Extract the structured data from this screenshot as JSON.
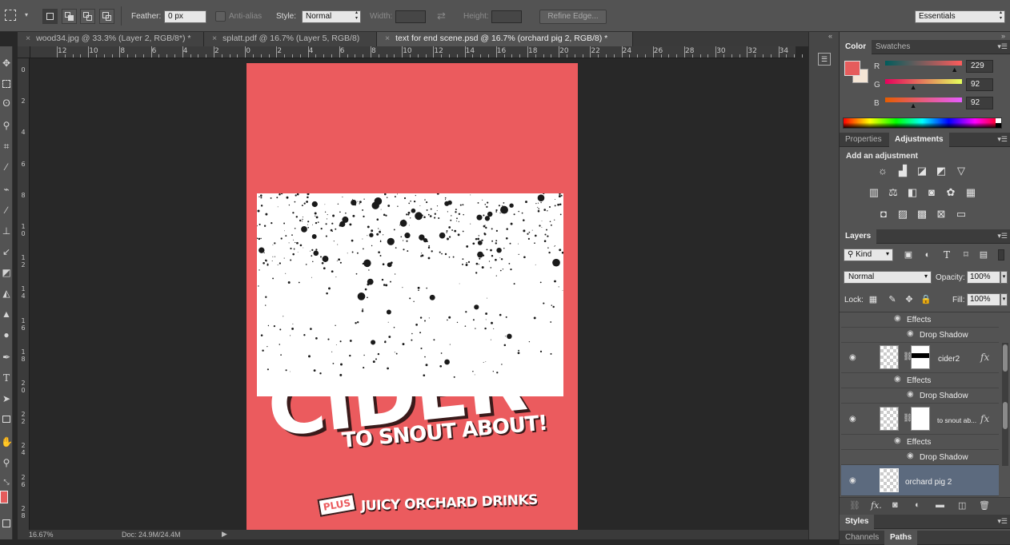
{
  "options_bar": {
    "feather_label": "Feather:",
    "feather_value": "0 px",
    "antialias_label": "Anti-alias",
    "style_label": "Style:",
    "style_value": "Normal",
    "width_label": "Width:",
    "height_label": "Height:",
    "refine_edge_label": "Refine Edge...",
    "workspace_value": "Essentials"
  },
  "tabs": [
    {
      "label": "wood34.jpg @ 33.3% (Layer 2, RGB/8*) *"
    },
    {
      "label": "splatt.pdf @ 16.7% (Layer 5, RGB/8)"
    },
    {
      "label": "text for end scene.psd @ 16.7% (orchard pig 2, RGB/8) *"
    }
  ],
  "ruler_h": [
    "12",
    "10",
    "8",
    "6",
    "4",
    "2",
    "0",
    "2",
    "4",
    "6",
    "8",
    "10",
    "12",
    "14",
    "16",
    "18",
    "20",
    "22",
    "24",
    "26",
    "28",
    "30",
    "32",
    "34"
  ],
  "ruler_v": [
    "0",
    "2",
    "4",
    "6",
    "8",
    "10",
    "12",
    "14",
    "16",
    "18",
    "20",
    "22",
    "24",
    "26",
    "28"
  ],
  "artwork": {
    "headline": "CIDER",
    "tagline": "TO SNOUT ABOUT!",
    "plus_badge": "PLUS",
    "footer": "JUICY ORCHARD DRINKS"
  },
  "status": {
    "zoom": "16.67%",
    "doc": "Doc: 24.9M/24.4M"
  },
  "color_panel": {
    "tab_color": "Color",
    "tab_swatches": "Swatches",
    "r_label": "R",
    "g_label": "G",
    "b_label": "B",
    "r_value": "229",
    "g_value": "92",
    "b_value": "92",
    "r_level": 0.898,
    "g_level": 0.361,
    "b_level": 0.361,
    "foreground": "#e55c5c",
    "background": "#f5e6d6"
  },
  "adjustments_panel": {
    "tab_properties": "Properties",
    "tab_adjustments": "Adjustments",
    "heading": "Add an adjustment",
    "icons": [
      "brightness-icon",
      "levels-icon",
      "curves-icon",
      "exposure-icon",
      "vibrance-icon",
      "hue-saturation-icon",
      "color-balance-icon",
      "black-white-icon",
      "photo-filter-icon",
      "channel-mixer-icon",
      "color-lookup-icon",
      "invert-icon",
      "posterize-icon",
      "threshold-icon",
      "gradient-map-icon",
      "selective-color-icon"
    ]
  },
  "layers_panel": {
    "tab_layers": "Layers",
    "kind_label": "Kind",
    "blend_mode": "Normal",
    "opacity_label": "Opacity:",
    "opacity_value": "100%",
    "lock_label": "Lock:",
    "fill_label": "Fill:",
    "fill_value": "100%",
    "effects_label": "Effects",
    "drop_shadow_label": "Drop Shadow",
    "layers": [
      {
        "name": "cider2"
      },
      {
        "name": "to snout ab..."
      },
      {
        "name": "orchard pig 2"
      }
    ]
  },
  "bottom_panels": {
    "styles_tab": "Styles",
    "channels_tab": "Channels",
    "paths_tab": "Paths"
  }
}
